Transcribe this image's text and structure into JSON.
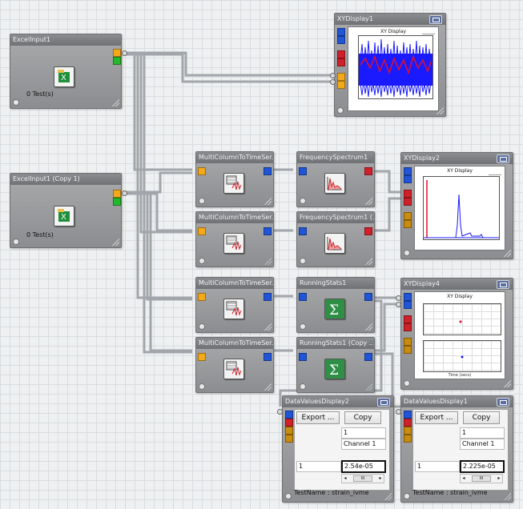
{
  "nodes": {
    "excel1": {
      "title": "ExcelInput1",
      "tests": "0 Test(s)"
    },
    "excel2": {
      "title": "ExcelInput1 (Copy 1)",
      "tests": "0 Test(s)"
    },
    "mc1": {
      "title": "MultiColumnToTimeSer..."
    },
    "mc2": {
      "title": "MultiColumnToTimeSer..."
    },
    "mc3": {
      "title": "MultiColumnToTimeSer..."
    },
    "mc4": {
      "title": "MultiColumnToTimeSer..."
    },
    "fs1": {
      "title": "FrequencySpectrum1"
    },
    "fs2": {
      "title": "FrequencySpectrum1 (..."
    },
    "rs1": {
      "title": "RunningStats1"
    },
    "rs2": {
      "title": "RunningStats1 (Copy ..."
    },
    "xy1": {
      "title": "XYDisplay1",
      "plot_title": "XY Display"
    },
    "xy2": {
      "title": "XYDisplay2",
      "plot_title": "XY Display"
    },
    "xy4": {
      "title": "XYDisplay4",
      "plot_title": "XY Display",
      "xlabel": "Time (secs)"
    },
    "dv2": {
      "title": "DataValuesDisplay2",
      "export_label": "Export ...",
      "copy_label": "Copy",
      "header_row1": "1",
      "header_row2": "Channel 1",
      "row_index": "1",
      "value": "2.54e-05",
      "scroll_label": "III",
      "test_name": "TestName : strain_ivme"
    },
    "dv1": {
      "title": "DataValuesDisplay1",
      "export_label": "Export ...",
      "copy_label": "Copy",
      "header_row1": "1",
      "header_row2": "Channel 1",
      "row_index": "1",
      "value": "2.225e-05",
      "scroll_label": "III",
      "test_name": "TestName : strain_ivme"
    }
  },
  "colors": {
    "port_orange": "#f3a91c",
    "port_green": "#22b92b",
    "port_blue": "#1f55d6",
    "port_red": "#d0202a",
    "wire": "#9a9ea3",
    "series_blue": "#1a1aff",
    "series_red": "#e0102a"
  }
}
